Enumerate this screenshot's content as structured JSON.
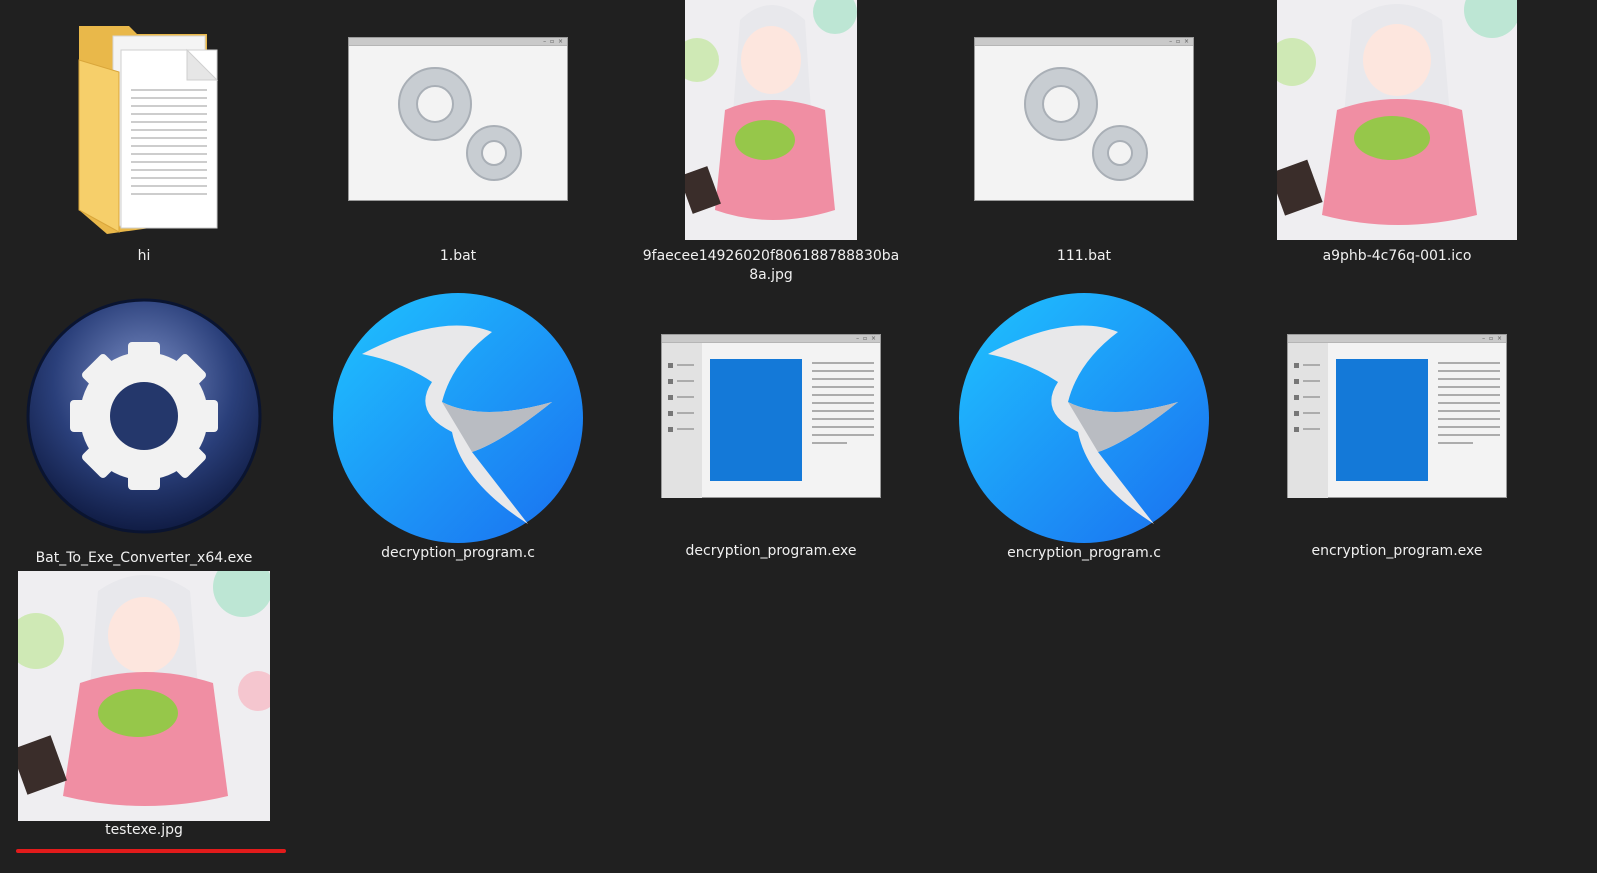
{
  "files": [
    {
      "name": "hi",
      "icon": "folder-icon"
    },
    {
      "name": "1.bat",
      "icon": "batch-file-icon"
    },
    {
      "name": "9faecee14926020f806188788830ba8a.jpg",
      "icon": "image-thumbnail"
    },
    {
      "name": "111.bat",
      "icon": "batch-file-icon"
    },
    {
      "name": "a9phb-4c76q-001.ico",
      "icon": "image-thumbnail"
    },
    {
      "name": "Bat_To_Exe_Converter_x64.exe",
      "icon": "gear-icon"
    },
    {
      "name": "decryption_program.c",
      "icon": "c-source-icon"
    },
    {
      "name": "decryption_program.exe",
      "icon": "exe-window-icon"
    },
    {
      "name": "encryption_program.c",
      "icon": "c-source-icon"
    },
    {
      "name": "encryption_program.exe",
      "icon": "exe-window-icon"
    },
    {
      "name": "testexe.jpg",
      "icon": "image-thumbnail"
    }
  ],
  "colors": {
    "background": "#202020",
    "highlight_underline": "#e21b1b",
    "folder": "#f6cf6a",
    "blue_icon": "#1a8cff"
  }
}
